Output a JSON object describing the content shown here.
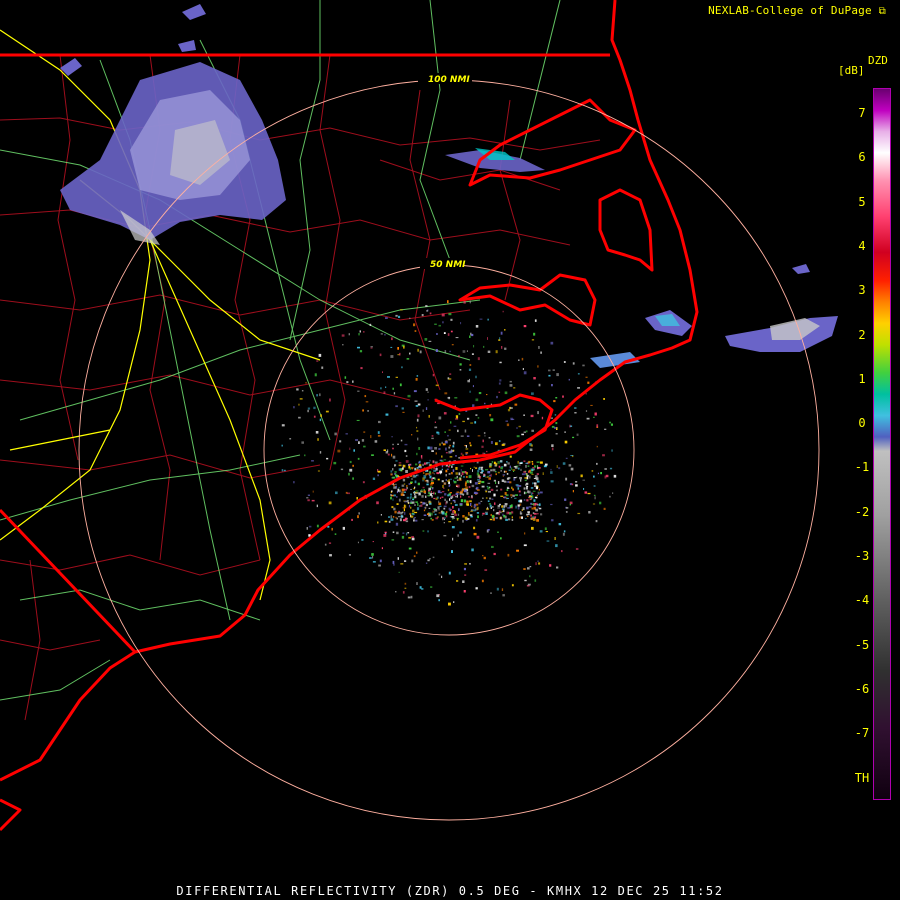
{
  "credit": "NEXLAB-College of DuPage",
  "legend": {
    "product": "DZD",
    "units": "[dB]",
    "ticks": [
      "7",
      "6",
      "5",
      "4",
      "3",
      "2",
      "1",
      "0",
      "-1",
      "-2",
      "-3",
      "-4",
      "-5",
      "-6",
      "-7",
      "TH"
    ]
  },
  "rings": [
    {
      "label": "50 NMI"
    },
    {
      "label": "100 NMI"
    }
  ],
  "footer": "DIFFERENTIAL REFLECTIVITY (ZDR) 0.5 DEG - KMHX 12 DEC 25 11:52",
  "colors": {
    "state_border": "#ff0000",
    "county_border": "#b01020",
    "highway": "#80ff80",
    "interstate": "#ffff00",
    "ring": "#ffb0a0",
    "legend_text": "#ffff00"
  }
}
